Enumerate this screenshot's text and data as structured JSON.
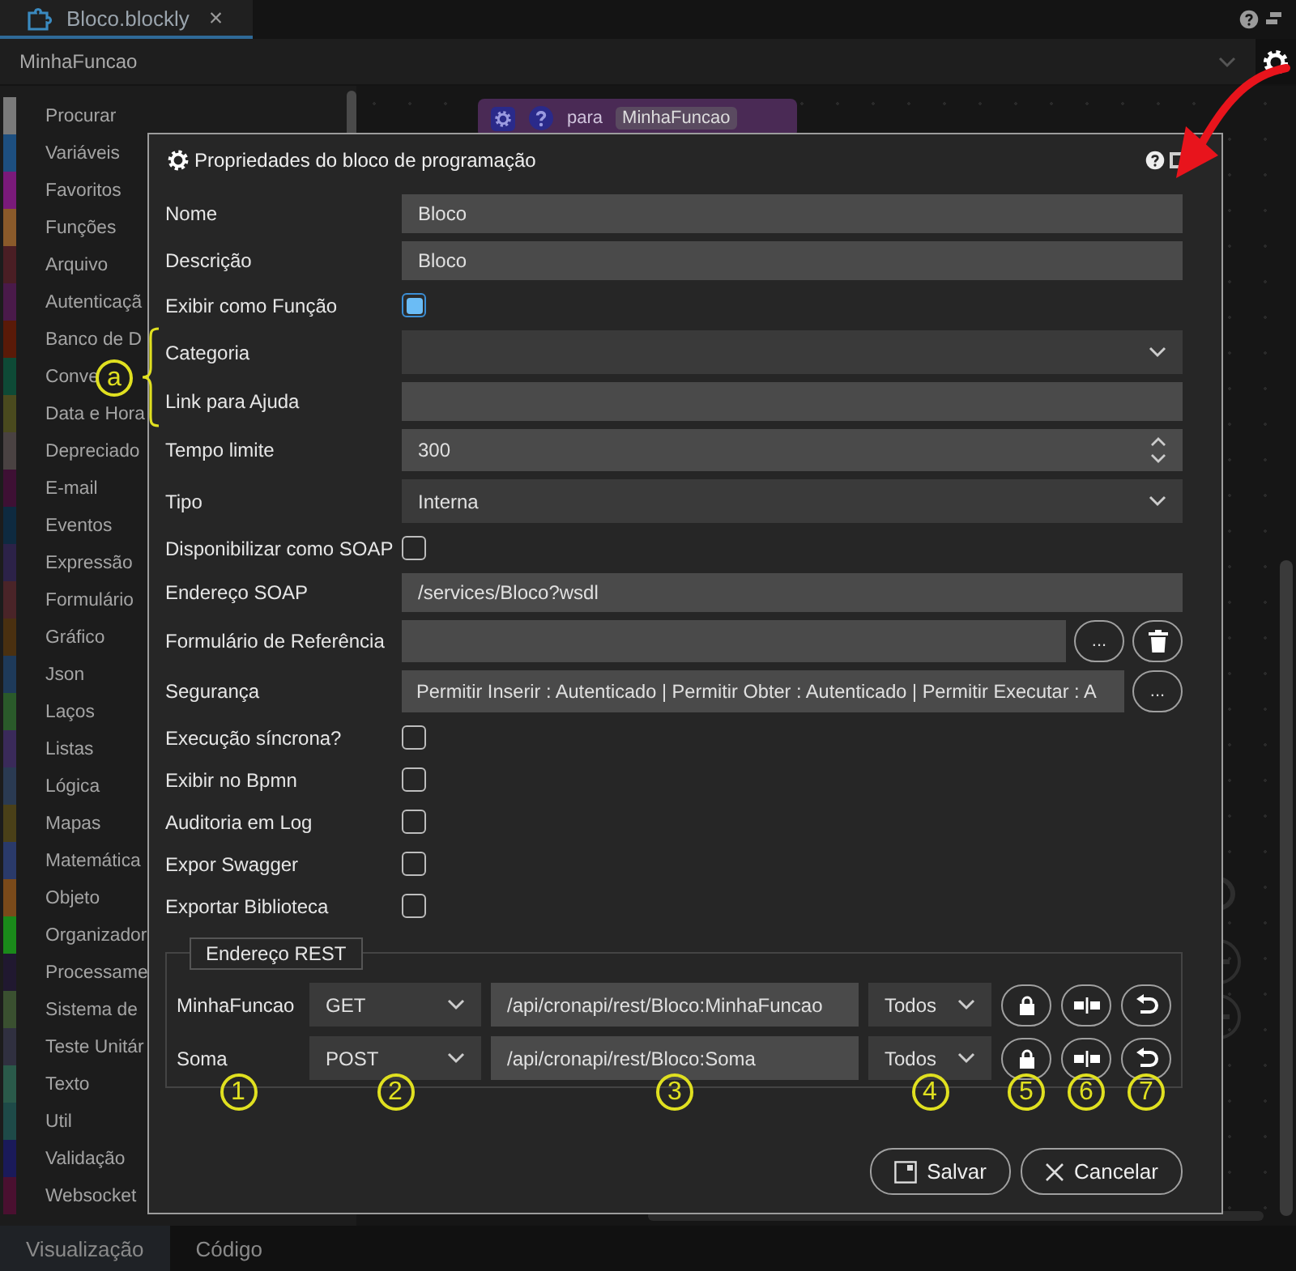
{
  "editor_tab": {
    "title": "Bloco.blockly",
    "close": "×",
    "selected": true
  },
  "function_selector": {
    "value": "MinhaFuncao"
  },
  "sidebar": {
    "items": [
      {
        "label": "Procurar",
        "color": "#7a7a7a"
      },
      {
        "label": "Variáveis",
        "color": "#1d4f80"
      },
      {
        "label": "Favoritos",
        "color": "#7a1a7a"
      },
      {
        "label": "Funções",
        "color": "#8a5a2a"
      },
      {
        "label": "Arquivo",
        "color": "#4a1e24"
      },
      {
        "label": "Autenticaçã",
        "color": "#4a1a4a"
      },
      {
        "label": "Banco de D",
        "color": "#5a1a08"
      },
      {
        "label": "Conve",
        "color": "#0e4a36"
      },
      {
        "label": "Data e Hora",
        "color": "#4a4a1e"
      },
      {
        "label": "Depreciado",
        "color": "#4a4242"
      },
      {
        "label": "E-mail",
        "color": "#3e1034"
      },
      {
        "label": "Eventos",
        "color": "#0e2a40"
      },
      {
        "label": "Expressão",
        "color": "#2c2248"
      },
      {
        "label": "Formulário",
        "color": "#4a2428"
      },
      {
        "label": "Gráfico",
        "color": "#4a3010"
      },
      {
        "label": "Json",
        "color": "#1e3a5a"
      },
      {
        "label": "Laços",
        "color": "#2a5a2a"
      },
      {
        "label": "Listas",
        "color": "#3a2a5a"
      },
      {
        "label": "Lógica",
        "color": "#2a3a52"
      },
      {
        "label": "Mapas",
        "color": "#4a4018"
      },
      {
        "label": "Matemática",
        "color": "#2a3a6a"
      },
      {
        "label": "Objeto",
        "color": "#7a4a1a"
      },
      {
        "label": "Organizador",
        "color": "#1a8a1a"
      },
      {
        "label": "Processame",
        "color": "#201830"
      },
      {
        "label": "Sistema de",
        "color": "#3a5030"
      },
      {
        "label": "Teste Unitár",
        "color": "#303040"
      },
      {
        "label": "Texto",
        "color": "#2a5a4a"
      },
      {
        "label": "Util",
        "color": "#1e4a48"
      },
      {
        "label": "Validação",
        "color": "#1a1a5a"
      },
      {
        "label": "Websocket",
        "color": "#4a1030"
      }
    ]
  },
  "canvas_block": {
    "keyword": "para",
    "name": "MinhaFuncao"
  },
  "dialog": {
    "title": "Propriedades do bloco de programação",
    "fields": [
      {
        "kind": "text",
        "label": "Nome",
        "value": "Bloco"
      },
      {
        "kind": "text",
        "label": "Descrição",
        "value": "Bloco"
      },
      {
        "kind": "checkbox",
        "label": "Exibir como Função",
        "checked": true
      },
      {
        "kind": "select",
        "label": "Categoria"
      },
      {
        "kind": "text",
        "label": "Link para Ajuda"
      },
      {
        "kind": "number",
        "label": "Tempo limite",
        "value": "300"
      },
      {
        "kind": "select",
        "label": "Tipo",
        "value": "Interna"
      },
      {
        "kind": "checkbox",
        "label": "Disponibilizar como SOAP",
        "checked": false
      },
      {
        "kind": "text",
        "label": "Endereço SOAP",
        "value": "/services/Bloco?wsdl"
      },
      {
        "kind": "picker",
        "label": "Formulário de Referência",
        "buttons": [
          {
            "kind": "more",
            "label": "..."
          },
          {
            "kind": "delete"
          }
        ]
      },
      {
        "kind": "picker",
        "label": "Segurança",
        "value": "Permitir Inserir : Autenticado | Permitir Obter : Autenticado | Permitir Executar : A",
        "buttons": [
          {
            "kind": "more",
            "label": "..."
          }
        ]
      },
      {
        "kind": "checkbox",
        "label": "Execução síncrona?",
        "checked": false
      },
      {
        "kind": "checkbox",
        "label": "Exibir no Bpmn",
        "checked": false
      },
      {
        "kind": "checkbox",
        "label": "Auditoria em Log",
        "checked": false
      },
      {
        "kind": "checkbox",
        "label": "Expor Swagger",
        "checked": false
      },
      {
        "kind": "checkbox",
        "label": "Exportar Biblioteca",
        "checked": false
      }
    ],
    "rest": {
      "legend": "Endereço REST",
      "rows": [
        {
          "name": "MinhaFuncao",
          "method": "GET",
          "url": "/api/cronapi/rest/Bloco:MinhaFuncao",
          "scope": "Todos"
        },
        {
          "name": "Soma",
          "method": "POST",
          "url": "/api/cronapi/rest/Bloco:Soma",
          "scope": "Todos"
        }
      ]
    },
    "buttons": [
      {
        "kind": "save",
        "label": "Salvar"
      },
      {
        "kind": "cancel",
        "label": "Cancelar"
      }
    ]
  },
  "bottom_tabs": [
    {
      "label": "Visualização",
      "selected": true
    },
    {
      "label": "Código",
      "selected": false
    }
  ],
  "annotations": {
    "brace_marker": "a",
    "column_markers": [
      "1",
      "2",
      "3",
      "4",
      "5",
      "6",
      "7"
    ]
  }
}
